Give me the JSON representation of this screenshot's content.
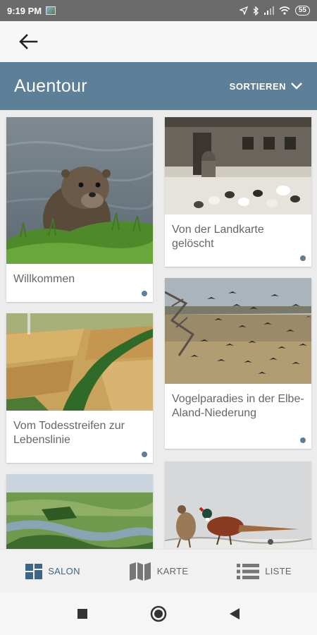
{
  "status_bar": {
    "time": "9:19 PM",
    "battery": "55"
  },
  "header": {
    "title": "Auentour",
    "sort_label": "SORTIEREN"
  },
  "cards": [
    {
      "caption": "Willkommen"
    },
    {
      "caption": "Von der Landkarte gelöscht"
    },
    {
      "caption": "Vom Todesstreifen zur Lebenslinie"
    },
    {
      "caption": "Vogelparadies in der Elbe-Aland-Niederung"
    },
    {
      "caption": ""
    },
    {
      "caption": ""
    }
  ],
  "bottom_nav": {
    "salon": "SALON",
    "karte": "KARTE",
    "liste": "LISTE"
  },
  "colors": {
    "accent": "#5d7f98",
    "active_nav": "#3d6585"
  }
}
